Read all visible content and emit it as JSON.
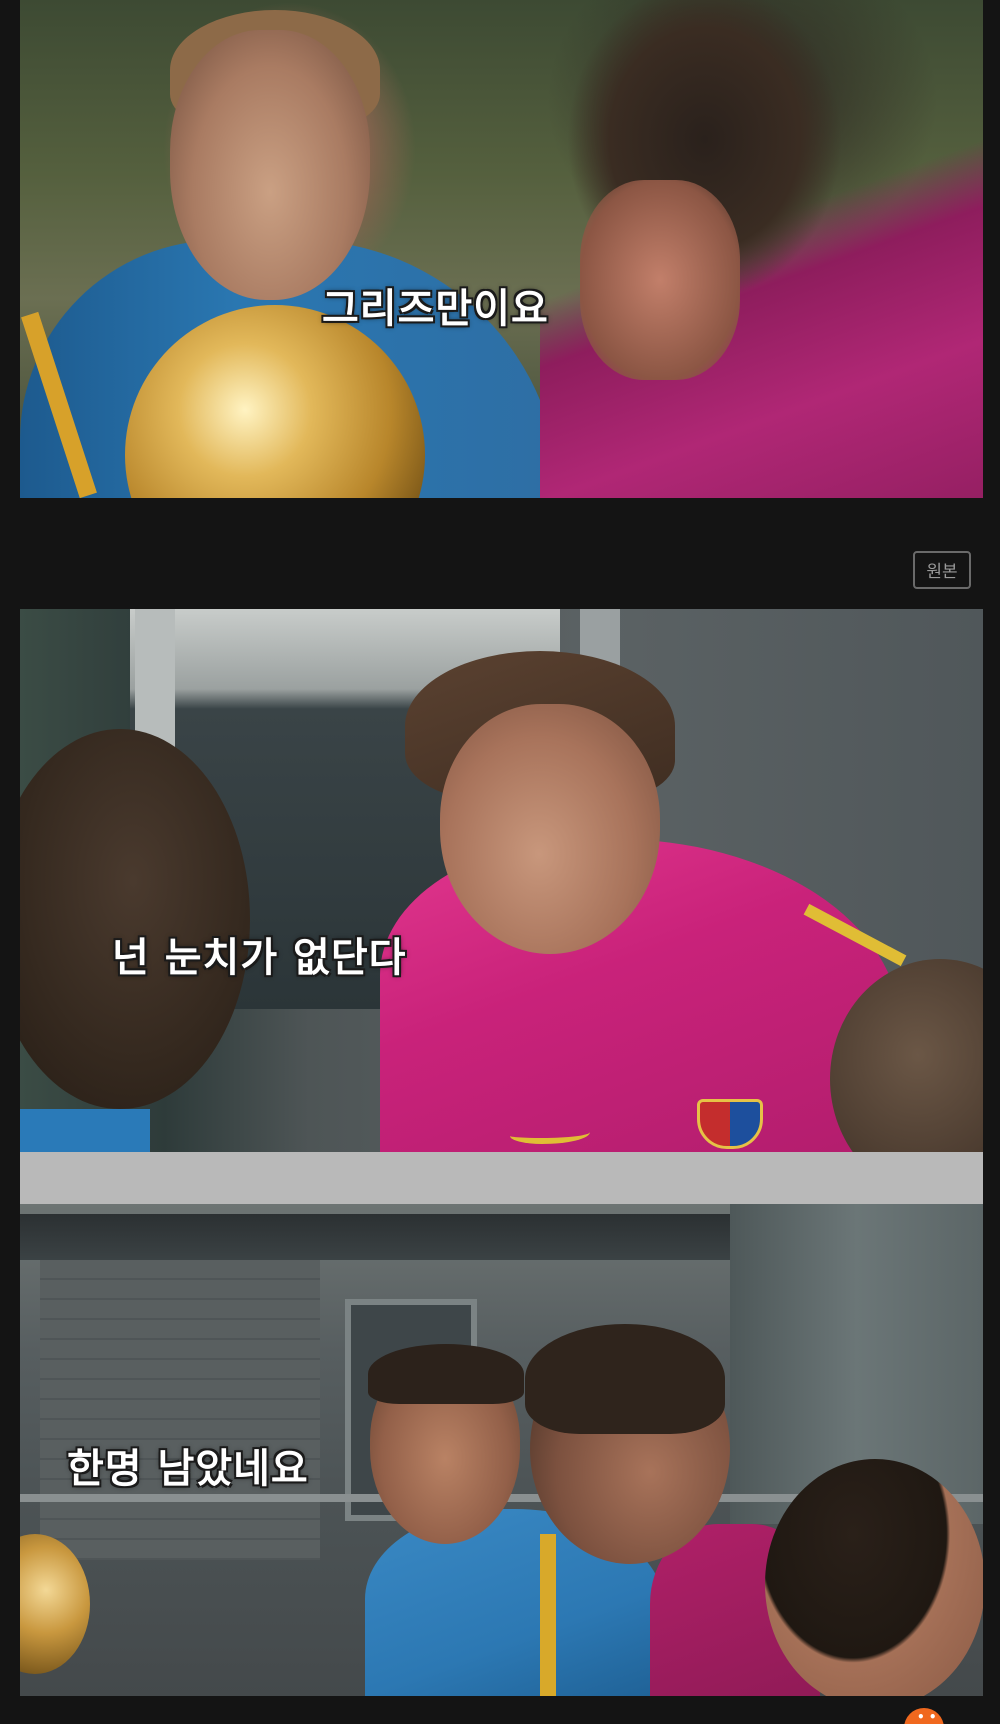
{
  "frames": [
    {
      "subtitle": "그리즈만이요"
    },
    {
      "subtitle": "넌 눈치가 없단다"
    },
    {
      "subtitle": "한명 남았네요"
    }
  ],
  "original_button": {
    "label": "원본"
  },
  "bottom_badge": {
    "glyph": "• •",
    "color": "#f0681e"
  },
  "colors": {
    "background": "#141414",
    "separator": "#b9b9b9",
    "subtitle_text": "#ffffff"
  }
}
